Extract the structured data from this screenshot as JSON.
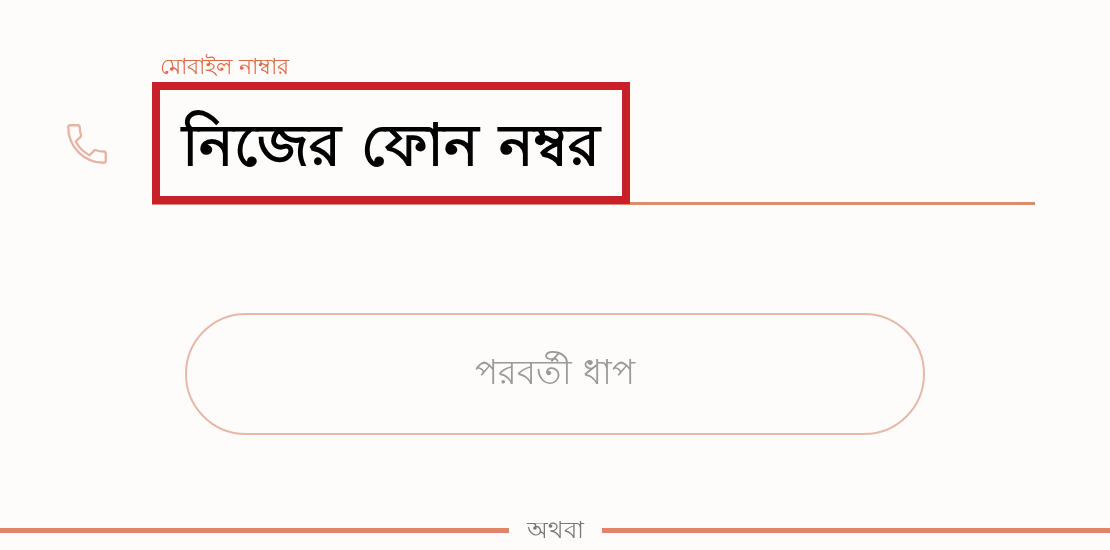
{
  "field": {
    "label": "মোবাইল নাম্বার",
    "value": "নিজের ফোন নম্বর",
    "highlighted": true
  },
  "button": {
    "label": "পরবর্তী ধাপ"
  },
  "divider": {
    "label": "অথবা"
  }
}
